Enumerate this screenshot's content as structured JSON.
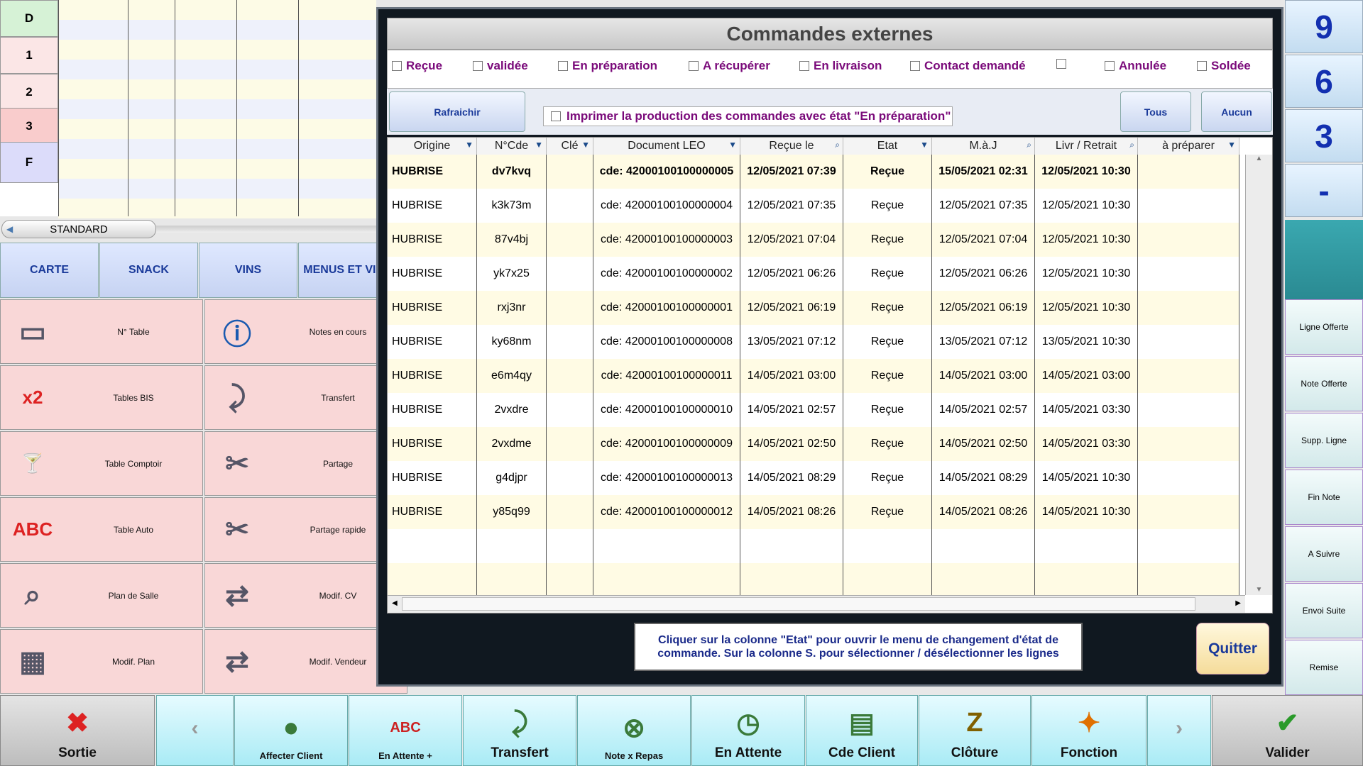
{
  "left_grid": {
    "row_labels": [
      "D",
      "1",
      "2",
      "3",
      "F"
    ]
  },
  "standard_label": "STANDARD",
  "categories": [
    "CARTE",
    "SNACK",
    "VINS",
    "MENUS ET VINS"
  ],
  "functions": [
    {
      "label": "N° Table",
      "icon": "table-icon"
    },
    {
      "label": "Notes en cours",
      "icon": "notes-info-icon"
    },
    {
      "label": "Tables BIS",
      "icon": "table-x2-icon"
    },
    {
      "label": "Transfert",
      "icon": "table-transfer-icon"
    },
    {
      "label": "Table Comptoir",
      "icon": "cocktail-table-icon"
    },
    {
      "label": "Partage",
      "icon": "scissors-note-icon"
    },
    {
      "label": "Table Auto",
      "icon": "table-abc-icon"
    },
    {
      "label": "Partage rapide",
      "icon": "fast-split-icon"
    },
    {
      "label": "Plan de Salle",
      "icon": "floor-plan-icon"
    },
    {
      "label": "Modif. CV",
      "icon": "cutlery-arrows-icon"
    },
    {
      "label": "Modif. Plan",
      "icon": "plan-edit-icon"
    },
    {
      "label": "Modif. Vendeur",
      "icon": "user-swap-icon"
    }
  ],
  "numpad": [
    "9",
    "6",
    "3",
    "-"
  ],
  "right_buttons": [
    "Ligne Offerte",
    "Note Offerte",
    "Supp. Ligne",
    "Fin Note",
    "A Suivre",
    "Envoi Suite",
    "Remise"
  ],
  "bottom_bar": [
    {
      "label": "Sortie",
      "icon": "close-x-icon"
    },
    {
      "label": "Affecter Client",
      "icon": "user-icon"
    },
    {
      "label": "En Attente +",
      "icon": "user-abc-icon"
    },
    {
      "label": "Transfert",
      "icon": "table-transfer-icon"
    },
    {
      "label": "Note x Repas",
      "icon": "note-cancel-icon"
    },
    {
      "label": "En Attente",
      "icon": "user-clock-icon"
    },
    {
      "label": "Cde Client",
      "icon": "user-doc-icon"
    },
    {
      "label": "Clôture",
      "icon": "cloture-icon"
    },
    {
      "label": "Fonction",
      "icon": "function-icon"
    },
    {
      "label": "Valider",
      "icon": "check-icon"
    }
  ],
  "colors": {
    "accent": "#1a3a9a",
    "status_purple": "#7a0a7a",
    "dialog_bg": "#101820"
  },
  "dialog": {
    "title": "Commandes externes",
    "filters": [
      "Reçue",
      "validée",
      "En préparation",
      "A récupérer",
      "En livraison",
      "Contact demandé",
      "",
      "Annulée",
      "Soldée"
    ],
    "refresh_label": "Rafraichir",
    "print_option": "Imprimer la production  des commandes avec état \"En préparation\"",
    "all_label": "Tous",
    "none_label": "Aucun",
    "columns": [
      "Origine",
      "N°Cde",
      "Clé",
      "Document LEO",
      "Reçue le",
      "Etat",
      "M.à.J",
      "Livr / Retrait",
      "à préparer"
    ],
    "rows": [
      [
        "HUBRISE",
        "dv7kvq",
        "",
        "cde: 42000100100000005",
        "12/05/2021 07:39",
        "Reçue",
        "15/05/2021 02:31",
        "12/05/2021 10:30",
        ""
      ],
      [
        "HUBRISE",
        "k3k73m",
        "",
        "cde: 42000100100000004",
        "12/05/2021 07:35",
        "Reçue",
        "12/05/2021 07:35",
        "12/05/2021 10:30",
        ""
      ],
      [
        "HUBRISE",
        "87v4bj",
        "",
        "cde: 42000100100000003",
        "12/05/2021 07:04",
        "Reçue",
        "12/05/2021 07:04",
        "12/05/2021 10:30",
        ""
      ],
      [
        "HUBRISE",
        "yk7x25",
        "",
        "cde: 42000100100000002",
        "12/05/2021 06:26",
        "Reçue",
        "12/05/2021 06:26",
        "12/05/2021 10:30",
        ""
      ],
      [
        "HUBRISE",
        "rxj3nr",
        "",
        "cde: 42000100100000001",
        "12/05/2021 06:19",
        "Reçue",
        "12/05/2021 06:19",
        "12/05/2021 10:30",
        ""
      ],
      [
        "HUBRISE",
        "ky68nm",
        "",
        "cde: 42000100100000008",
        "13/05/2021 07:12",
        "Reçue",
        "13/05/2021 07:12",
        "13/05/2021 10:30",
        ""
      ],
      [
        "HUBRISE",
        "e6m4qy",
        "",
        "cde: 42000100100000011",
        "14/05/2021 03:00",
        "Reçue",
        "14/05/2021 03:00",
        "14/05/2021 03:00",
        ""
      ],
      [
        "HUBRISE",
        "2vxdre",
        "",
        "cde: 42000100100000010",
        "14/05/2021 02:57",
        "Reçue",
        "14/05/2021 02:57",
        "14/05/2021 03:30",
        ""
      ],
      [
        "HUBRISE",
        "2vxdme",
        "",
        "cde: 42000100100000009",
        "14/05/2021 02:50",
        "Reçue",
        "14/05/2021 02:50",
        "14/05/2021 03:30",
        ""
      ],
      [
        "HUBRISE",
        "g4djpr",
        "",
        "cde: 42000100100000013",
        "14/05/2021 08:29",
        "Reçue",
        "14/05/2021 08:29",
        "14/05/2021 10:30",
        ""
      ],
      [
        "HUBRISE",
        "y85q99",
        "",
        "cde: 42000100100000012",
        "14/05/2021 08:26",
        "Reçue",
        "14/05/2021 08:26",
        "14/05/2021 10:30",
        ""
      ]
    ],
    "info_text": "Cliquer sur la colonne \"Etat\" pour ouvrir le menu de changement d'état de commande. Sur la colonne S. pour sélectionner / désélectionner les lignes",
    "quit_label": "Quitter"
  }
}
